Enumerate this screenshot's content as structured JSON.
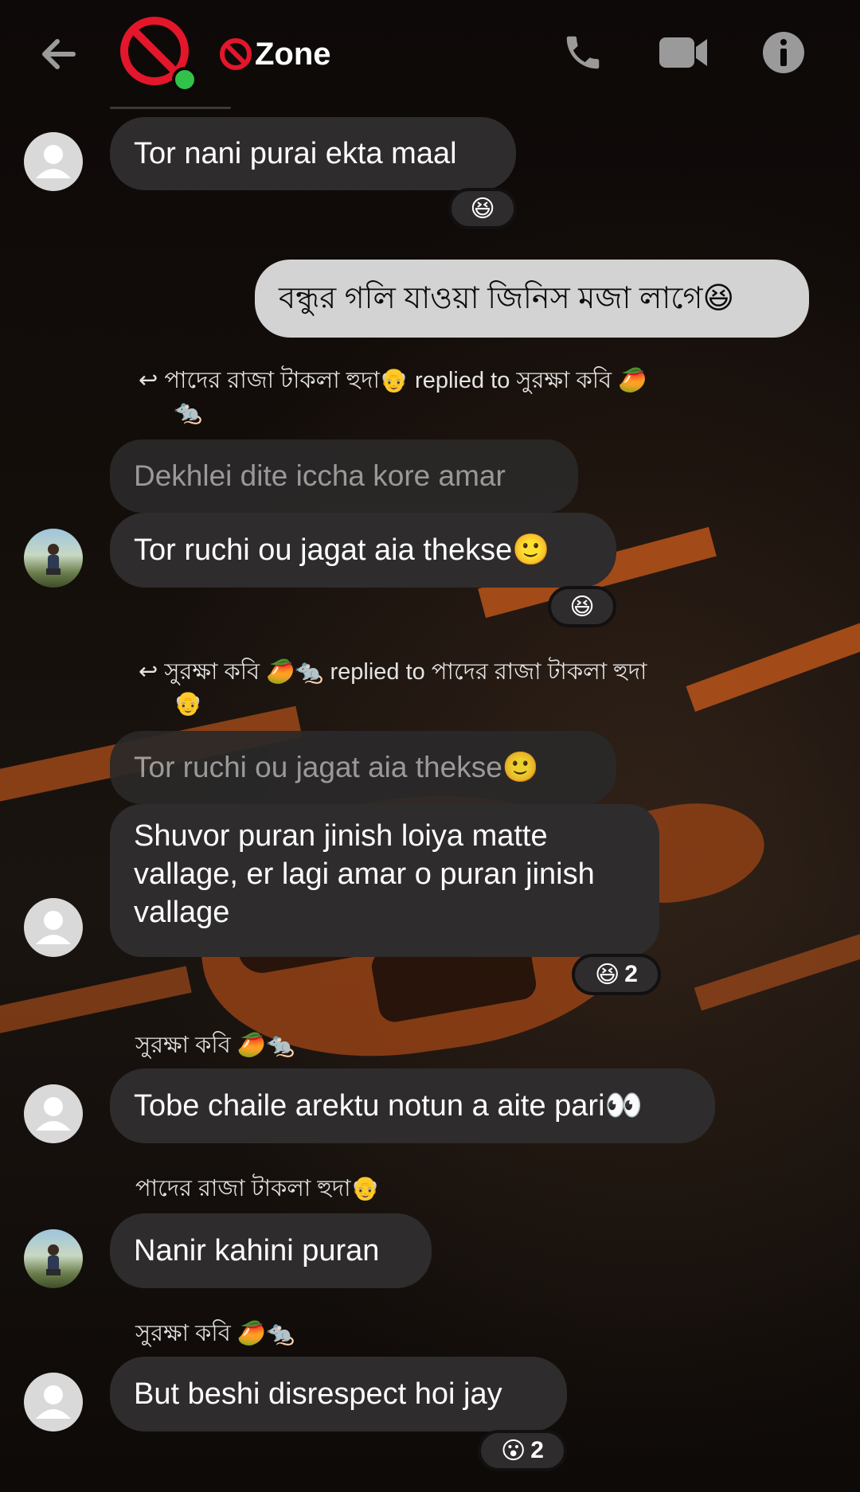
{
  "header": {
    "title": "Zone",
    "colors": {
      "accent": "#e3162b",
      "online": "#31c24a"
    },
    "icons": [
      "back-arrow-icon",
      "group-avatar-ban-icon",
      "ban-icon",
      "phone-icon",
      "video-camera-icon",
      "info-icon"
    ]
  },
  "messages": [
    {
      "text": "Tor nani purai ekta maal",
      "reaction": "😆"
    },
    {
      "text": "বন্ধুর গলি যাওয়া জিনিস মজা লাগে😆"
    },
    {
      "reply_meta_line1": "পাদের রাজা টাকলা হুদা👴 replied to সুরক্ষা কবি 🥭",
      "reply_meta_line2": "🐀",
      "quoted": "Dekhlei dite iccha kore amar",
      "text": "Tor ruchi ou jagat aia thekse🙂",
      "reaction": "😆"
    },
    {
      "reply_meta_line1": "সুরক্ষা কবি 🥭🐀 replied to পাদের রাজা টাকলা হুদা",
      "reply_meta_line2": "👴",
      "quoted": "Tor ruchi ou jagat aia thekse🙂",
      "text": "Shuvor puran jinish loiya matte vallage, er lagi amar o puran jinish vallage",
      "reaction": "😆",
      "reaction_count": "2"
    },
    {
      "sender": "সুরক্ষা কবি 🥭🐀",
      "text": "Tobe chaile arektu notun a aite pari👀"
    },
    {
      "sender": "পাদের রাজা টাকলা হুদা👴",
      "text": "Nanir kahini puran"
    },
    {
      "sender": "সুরক্ষা কবি 🥭🐀",
      "text": "But beshi disrespect hoi jay",
      "reaction": "😮",
      "reaction_count": "2"
    }
  ]
}
